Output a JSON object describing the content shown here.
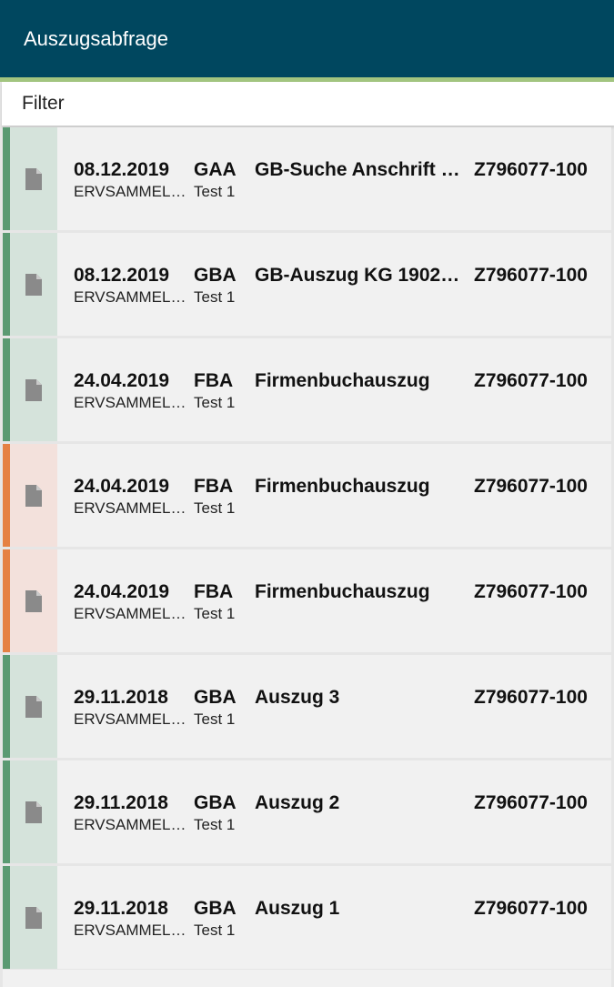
{
  "header": {
    "title": "Auszugsabfrage"
  },
  "filter": {
    "label": "Filter"
  },
  "colors": {
    "header_bg": "#00475f",
    "header_stripe": "#a2c57f",
    "status_green": "#5a9a72",
    "status_orange": "#e58143"
  },
  "rows": [
    {
      "status": "green",
      "icon": "document-icon",
      "date": "08.12.2019",
      "type": "GAA",
      "title": "GB-Suche Anschrift L…",
      "number": "Z796077-100",
      "user": "ERVSAMMEL…",
      "note": "Test 1"
    },
    {
      "status": "green",
      "icon": "document-icon",
      "date": "08.12.2019",
      "type": "GBA",
      "title": "GB-Auszug KG 1902 …",
      "number": "Z796077-100",
      "user": "ERVSAMMEL…",
      "note": "Test 1"
    },
    {
      "status": "green",
      "icon": "document-icon",
      "date": "24.04.2019",
      "type": "FBA",
      "title": "Firmenbuchauszug",
      "number": "Z796077-100",
      "user": "ERVSAMMEL…",
      "note": "Test 1"
    },
    {
      "status": "orange",
      "icon": "document-icon",
      "date": "24.04.2019",
      "type": "FBA",
      "title": "Firmenbuchauszug",
      "number": "Z796077-100",
      "user": "ERVSAMMEL…",
      "note": "Test 1"
    },
    {
      "status": "orange",
      "icon": "document-icon",
      "date": "24.04.2019",
      "type": "FBA",
      "title": "Firmenbuchauszug",
      "number": "Z796077-100",
      "user": "ERVSAMMEL…",
      "note": "Test 1"
    },
    {
      "status": "green",
      "icon": "document-icon",
      "date": "29.11.2018",
      "type": "GBA",
      "title": "Auszug 3",
      "number": "Z796077-100",
      "user": "ERVSAMMEL…",
      "note": "Test 1"
    },
    {
      "status": "green",
      "icon": "document-icon",
      "date": "29.11.2018",
      "type": "GBA",
      "title": "Auszug 2",
      "number": "Z796077-100",
      "user": "ERVSAMMEL…",
      "note": "Test 1"
    },
    {
      "status": "green",
      "icon": "document-icon",
      "date": "29.11.2018",
      "type": "GBA",
      "title": "Auszug 1",
      "number": "Z796077-100",
      "user": "ERVSAMMEL…",
      "note": "Test 1"
    }
  ]
}
